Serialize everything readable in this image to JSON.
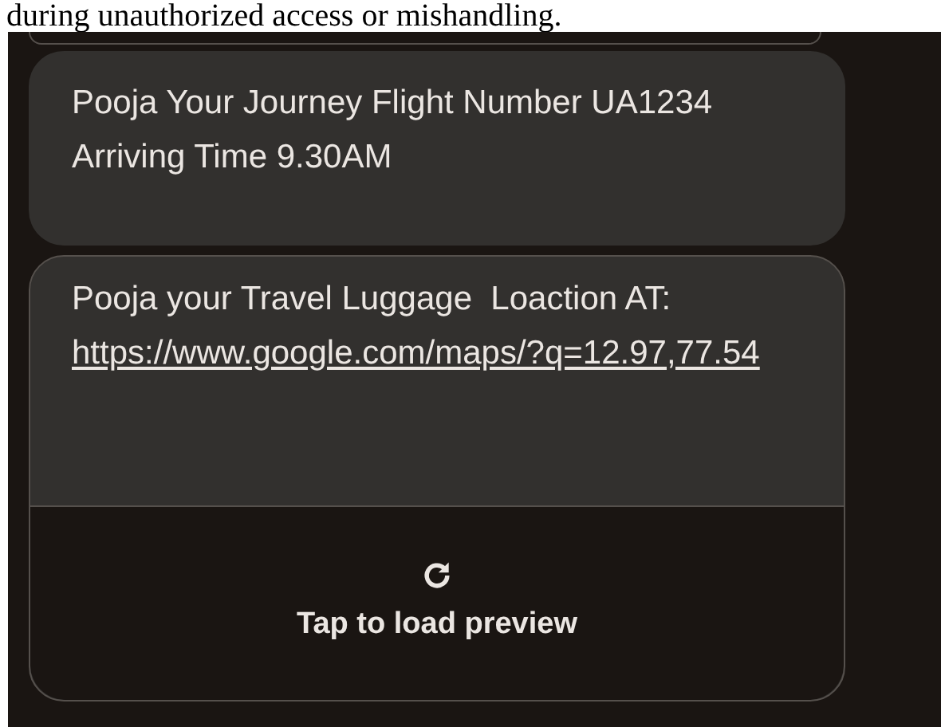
{
  "document_text": "during unauthorized access or mishandling.",
  "messages": [
    {
      "kind": "text",
      "text": "Pooja Your Journey Flight Number UA1234 Arriving Time 9.30AM"
    },
    {
      "kind": "link_preview",
      "text": "Pooja your Travel Luggage  Loaction AT:",
      "link": "https://www.google.com/maps/?q=12.97,77.54",
      "preview_label": "Tap to load preview"
    }
  ]
}
